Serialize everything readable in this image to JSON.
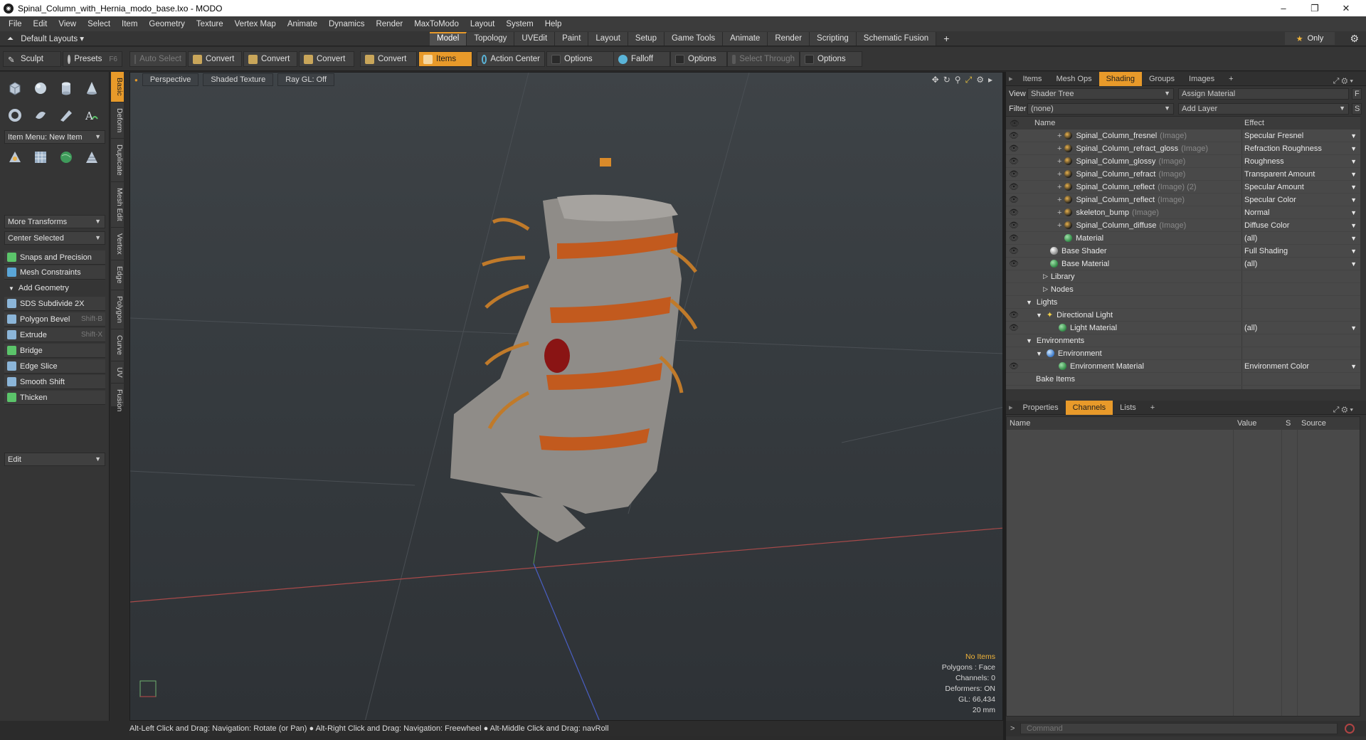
{
  "window": {
    "title": "Spinal_Column_with_Hernia_modo_base.lxo - MODO",
    "minimize": "–",
    "maximize": "❐",
    "close": "✕"
  },
  "menu": [
    "File",
    "Edit",
    "View",
    "Select",
    "Item",
    "Geometry",
    "Texture",
    "Vertex Map",
    "Animate",
    "Dynamics",
    "Render",
    "MaxToModo",
    "Layout",
    "System",
    "Help"
  ],
  "layout": {
    "preset": "Default Layouts ▾",
    "tabs": [
      "Model",
      "Topology",
      "UVEdit",
      "Paint",
      "Layout",
      "Setup",
      "Game Tools",
      "Animate",
      "Render",
      "Scripting",
      "Schematic Fusion"
    ],
    "active_tab": "Model",
    "add": "+",
    "only": "Only"
  },
  "toolbar": {
    "sculpt": "Sculpt",
    "presets": "Presets",
    "presets_key": "F6",
    "auto_select": "Auto Select",
    "convert1": "Convert",
    "convert2": "Convert",
    "convert3": "Convert",
    "convert4": "Convert",
    "items": "Items",
    "action_center": "Action Center",
    "options1": "Options",
    "falloff": "Falloff",
    "options2": "Options",
    "select_through": "Select Through",
    "options3": "Options"
  },
  "left": {
    "item_menu": "Item Menu: New Item",
    "more_transforms": "More Transforms",
    "center_selected": "Center Selected",
    "snaps": "Snaps and Precision",
    "mesh_constraints": "Mesh Constraints",
    "add_geometry": "Add Geometry",
    "tools": [
      {
        "label": "SDS Subdivide 2X",
        "key": ""
      },
      {
        "label": "Polygon Bevel",
        "key": "Shift-B"
      },
      {
        "label": "Extrude",
        "key": "Shift-X"
      },
      {
        "label": "Bridge",
        "key": ""
      },
      {
        "label": "Edge Slice",
        "key": ""
      },
      {
        "label": "Smooth Shift",
        "key": ""
      },
      {
        "label": "Thicken",
        "key": ""
      }
    ],
    "edit": "Edit",
    "vtabs": [
      "Basic",
      "Deform",
      "Duplicate",
      "Mesh Edit",
      "Vertex",
      "Edge",
      "Polygon",
      "Curve",
      "UV",
      "Fusion"
    ]
  },
  "viewport": {
    "view": "Perspective",
    "shading": "Shaded Texture",
    "raygl": "Ray GL: Off",
    "info": {
      "items": "No Items",
      "polygons": "Polygons : Face",
      "channels": "Channels: 0",
      "deformers": "Deformers: ON",
      "gl": "GL: 66,434",
      "scale": "20 mm"
    }
  },
  "status": "Alt-Left Click and Drag: Navigation: Rotate (or Pan) ● Alt-Right Click and Drag: Navigation: Freewheel ● Alt-Middle Click and Drag: navRoll",
  "shading": {
    "tabs": [
      "Items",
      "Mesh Ops",
      "Shading",
      "Groups",
      "Images"
    ],
    "active": "Shading",
    "add": "+",
    "view_label": "View",
    "view_value": "Shader Tree",
    "assign": "Assign Material",
    "f": "F",
    "filter_label": "Filter",
    "filter_value": "(none)",
    "add_layer": "Add Layer",
    "s": "S",
    "col_name": "Name",
    "col_effect": "Effect",
    "rows": [
      {
        "name": "Spinal_Column_fresnel",
        "suffix": "(Image)",
        "effect": "Specular Fresnel"
      },
      {
        "name": "Spinal_Column_refract_gloss",
        "suffix": "(Image)",
        "effect": "Refraction Roughness"
      },
      {
        "name": "Spinal_Column_glossy",
        "suffix": "(Image)",
        "effect": "Roughness"
      },
      {
        "name": "Spinal_Column_refract",
        "suffix": "(Image)",
        "effect": "Transparent Amount"
      },
      {
        "name": "Spinal_Column_reflect",
        "suffix": "(Image) (2)",
        "effect": "Specular Amount"
      },
      {
        "name": "Spinal_Column_reflect",
        "suffix": "(Image)",
        "effect": "Specular Color"
      },
      {
        "name": "skeleton_bump",
        "suffix": "(Image)",
        "effect": "Normal"
      },
      {
        "name": "Spinal_Column_diffuse",
        "suffix": "(Image)",
        "effect": "Diffuse Color"
      },
      {
        "name": "Material",
        "suffix": "",
        "effect": "(all)"
      },
      {
        "name": "Base Shader",
        "suffix": "",
        "effect": "Full Shading"
      },
      {
        "name": "Base Material",
        "suffix": "",
        "effect": "(all)"
      },
      {
        "name": "Library",
        "suffix": "",
        "effect": ""
      },
      {
        "name": "Nodes",
        "suffix": "",
        "effect": ""
      },
      {
        "name": "Lights",
        "suffix": "",
        "effect": ""
      },
      {
        "name": "Directional Light",
        "suffix": "",
        "effect": ""
      },
      {
        "name": "Light Material",
        "suffix": "",
        "effect": "(all)"
      },
      {
        "name": "Environments",
        "suffix": "",
        "effect": ""
      },
      {
        "name": "Environment",
        "suffix": "",
        "effect": ""
      },
      {
        "name": "Environment Material",
        "suffix": "",
        "effect": "Environment Color"
      },
      {
        "name": "Bake Items",
        "suffix": "",
        "effect": ""
      }
    ]
  },
  "channels": {
    "tabs": [
      "Properties",
      "Channels",
      "Lists"
    ],
    "active": "Channels",
    "add": "+",
    "cols": [
      "Name",
      "Value",
      "S",
      "Source"
    ]
  },
  "command": {
    "placeholder": "Command",
    "prompt": ">"
  }
}
